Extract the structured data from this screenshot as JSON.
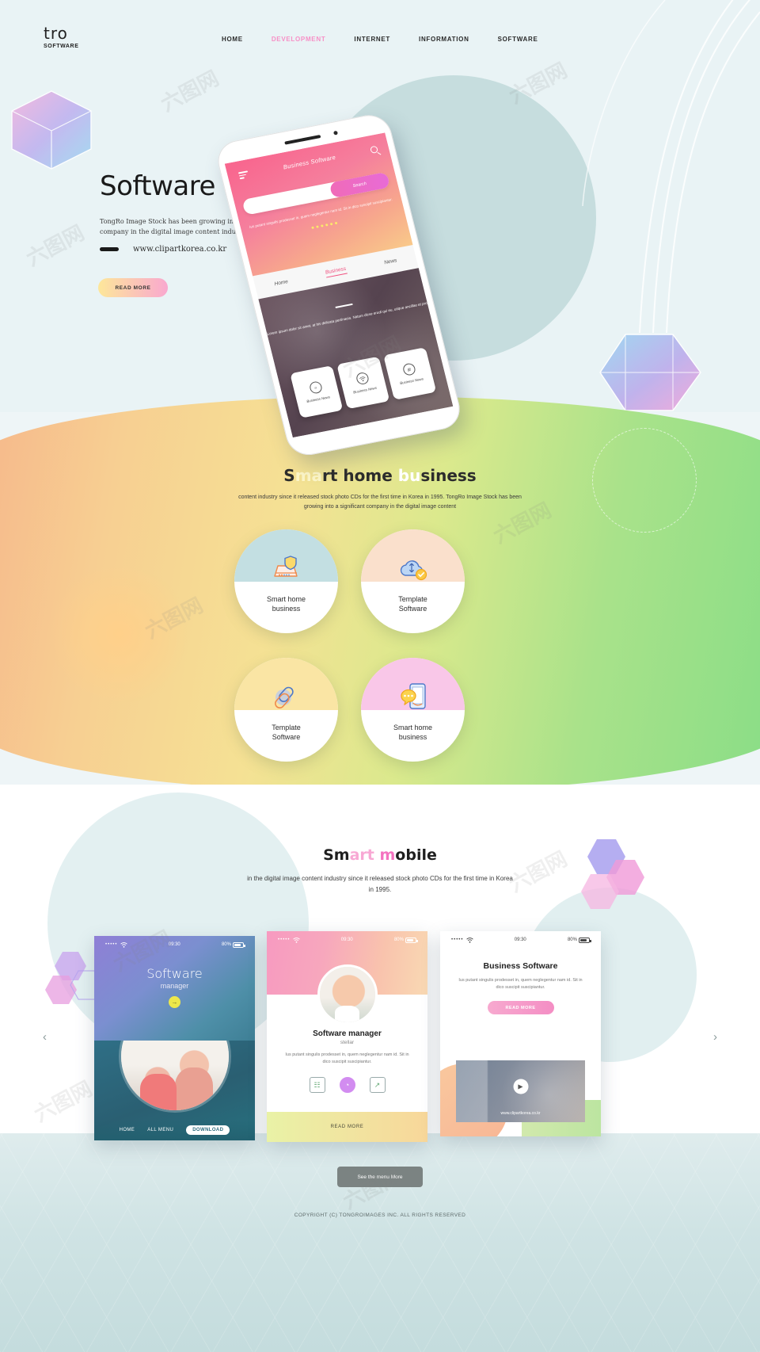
{
  "header": {
    "logo_main": "tro",
    "logo_sub": "SOFTWARE",
    "nav": [
      {
        "label": "HOME",
        "active": false
      },
      {
        "label": "DEVELOPMENT",
        "active": true
      },
      {
        "label": "INTERNET",
        "active": false
      },
      {
        "label": "INFORMATION",
        "active": false
      },
      {
        "label": "SOFTWARE",
        "active": false
      }
    ],
    "accent_color": "#f78fc6"
  },
  "hero": {
    "title": "Software business",
    "description": "TongRo Image Stock has been growing into a significant company in the digital image content industry since it",
    "url": "www.clipartkorea.co.kr",
    "button": "READ MORE",
    "phone": {
      "app_title": "Business Software",
      "search_button": "Search",
      "lorem": "Ius putant singulis prodesset in, quem neglegentur nam id. Sit in dico suscipit suscipiantur.",
      "tabs": [
        {
          "label": "Home",
          "active": false
        },
        {
          "label": "Business",
          "active": true
        },
        {
          "label": "News",
          "active": false
        }
      ],
      "photo_text": "Lorem ipsum dolor sit amet, at his delicata pertinacia. Natum dicse erudi qui eu, utique ancillae et pro",
      "cards": [
        {
          "label": "Business News",
          "icon": "clock-icon",
          "glyph": "⦸"
        },
        {
          "label": "Business News",
          "icon": "wifi-icon",
          "glyph": "ᴘ"
        },
        {
          "label": "Business News",
          "icon": "document-icon",
          "glyph": "▤"
        }
      ]
    }
  },
  "smart_home": {
    "title_parts": [
      {
        "text": "S",
        "style": "dark"
      },
      {
        "text": "ma",
        "style": "light"
      },
      {
        "text": "rt home ",
        "style": "dark"
      },
      {
        "text": "bu",
        "style": "white"
      },
      {
        "text": "siness",
        "style": "dark"
      }
    ],
    "title_plain": "Smart home business",
    "description": "content industry since it released stock photo CDs for the first time in Korea in 1995. TongRo Image Stock has been growing into a significant company in the digital image content",
    "circles": [
      {
        "label": "Smart home business",
        "line1": "Smart home",
        "line2": "business",
        "top_color": "#c3dfe2",
        "icon": "shield-router-icon"
      },
      {
        "label": "Template Software",
        "line1": "Template",
        "line2": "Software",
        "top_color": "#fae0cc",
        "icon": "cloud-sync-icon"
      },
      {
        "label": "Template Software",
        "line1": "Template",
        "line2": "Software",
        "top_color": "#fae5a4",
        "icon": "link-chain-icon"
      },
      {
        "label": "Smart home business",
        "line1": "Smart home",
        "line2": "business",
        "top_color": "#f9c7e8",
        "icon": "phone-chat-icon"
      }
    ]
  },
  "smart_mobile": {
    "title_parts": [
      {
        "text": "Sm",
        "style": "dark"
      },
      {
        "text": "art ",
        "style": "pink-light"
      },
      {
        "text": "m",
        "style": "pink"
      },
      {
        "text": "obile",
        "style": "dark"
      }
    ],
    "title_plain": "Smart mobile",
    "description": "in the digital image content industry since it released stock photo CDs for the first time in Korea in 1995.",
    "status_bar": {
      "signal": "•••••",
      "wifi": "wifi-icon",
      "time": "09:30",
      "battery": "80%"
    },
    "prev_arrow": "‹",
    "next_arrow": "›",
    "cards": [
      {
        "title": "Software",
        "subtitle": "manager",
        "arrow_glyph": "→",
        "nav": [
          {
            "label": "HOME",
            "primary": false
          },
          {
            "label": "ALL MENU",
            "primary": false
          },
          {
            "label": "DOWNLOAD",
            "primary": true
          }
        ]
      },
      {
        "name": "Software manager",
        "role": "stellar",
        "lorem": "Ius putant singulis prodesset in, quem neglegentur nam id. Sit in dico suscipit suscipiantur.",
        "icons": [
          {
            "name": "chart-icon",
            "glyph": "☷",
            "highlight": false
          },
          {
            "name": "pie-chart-icon",
            "glyph": "◔",
            "highlight": true
          },
          {
            "name": "graph-icon",
            "glyph": "↗",
            "highlight": false
          }
        ],
        "footer_button": "READ MORE"
      },
      {
        "title": "Business Software",
        "lorem": "Ius putant singulis prodesset in, quem neglegentur nam id. Sit in dico suscipit suscipiantur.",
        "button": "READ MORE",
        "play_glyph": "▶",
        "media_url": "www.clipartkorea.co.kr"
      }
    ]
  },
  "footer": {
    "menu_button": "See the menu More",
    "copyright": "COPYRIGHT (C) TONGROIMAGES INC. ALL RIGHTS RESERVED"
  }
}
